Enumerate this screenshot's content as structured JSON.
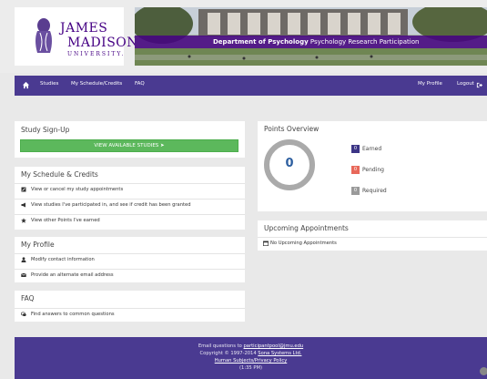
{
  "logo": {
    "line1": "JAMES",
    "line2": "MADISON",
    "line3": "UNIVERSITY."
  },
  "banner": {
    "department": "Department of Psychology",
    "subtitle": "Psychology Research Participation"
  },
  "nav": {
    "items": [
      {
        "label": "Studies"
      },
      {
        "label": "My Schedule/Credits"
      },
      {
        "label": "FAQ"
      }
    ],
    "right": [
      {
        "label": "My Profile"
      },
      {
        "label": "Logout"
      }
    ]
  },
  "study_signup": {
    "title": "Study Sign-Up",
    "button_label": "VIEW AVAILABLE STUDIES"
  },
  "schedule": {
    "title": "My Schedule & Credits",
    "items": [
      {
        "label": "View or cancel my study appointments"
      },
      {
        "label": "View studies I've participated in, and see if credit has been granted"
      },
      {
        "label": "View other Points I've earned"
      }
    ]
  },
  "profile": {
    "title": "My Profile",
    "items": [
      {
        "label": "Modify contact information"
      },
      {
        "label": "Provide an alternate email address"
      }
    ]
  },
  "faq": {
    "title": "FAQ",
    "items": [
      {
        "label": "Find answers to common questions"
      }
    ]
  },
  "points": {
    "title": "Points Overview",
    "value": "0",
    "legend": [
      {
        "label": "Earned",
        "color": "#3c3586",
        "value": "0"
      },
      {
        "label": "Pending",
        "color": "#e8685a",
        "value": "0"
      },
      {
        "label": "Required",
        "color": "#9a9a9a",
        "value": "0"
      }
    ]
  },
  "appointments": {
    "title": "Upcoming Appointments",
    "empty_text": "No Upcoming Appointments"
  },
  "footer": {
    "email_prefix": "Email questions to",
    "email": "participantpool@jmu.edu",
    "copyright_prefix": "Copyright © 1997-2014",
    "company": "Sona Systems Ltd.",
    "privacy": "Human Subjects/Privacy Policy",
    "time": "(1:35 PM)"
  },
  "colors": {
    "brand_purple": "#4a3a91",
    "button_green": "#5cb85c",
    "ring_gray": "#aaaaaa"
  }
}
